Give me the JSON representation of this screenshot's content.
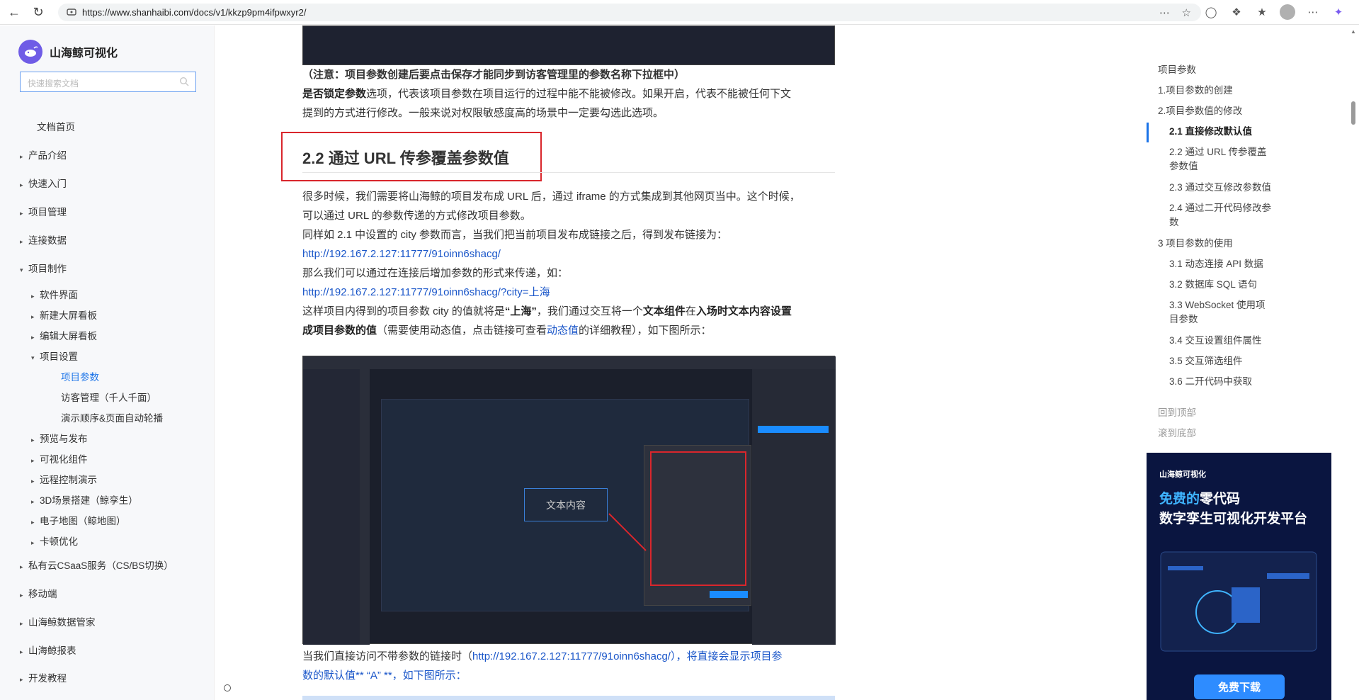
{
  "browser": {
    "url": "https://www.shanhaibi.com/docs/v1/kkzp9pm4ifpwxyr2/"
  },
  "sidebar": {
    "brand": "山海鲸可视化",
    "search_placeholder": "快速搜索文档",
    "items": [
      {
        "label": "文档首页",
        "caret": ""
      },
      {
        "label": "产品介绍",
        "caret": "▸"
      },
      {
        "label": "快速入门",
        "caret": "▸"
      },
      {
        "label": "项目管理",
        "caret": "▸"
      },
      {
        "label": "连接数据",
        "caret": "▸"
      },
      {
        "label": "项目制作",
        "caret": "▾"
      },
      {
        "label": "软件界面",
        "caret": "▸"
      },
      {
        "label": "新建大屏看板",
        "caret": "▸"
      },
      {
        "label": "编辑大屏看板",
        "caret": "▸"
      },
      {
        "label": "项目设置",
        "caret": "▾"
      },
      {
        "label": "项目参数",
        "caret": ""
      },
      {
        "label": "访客管理（千人千面）",
        "caret": ""
      },
      {
        "label": "演示顺序&页面自动轮播",
        "caret": ""
      },
      {
        "label": "预览与发布",
        "caret": "▸"
      },
      {
        "label": "可视化组件",
        "caret": "▸"
      },
      {
        "label": "远程控制演示",
        "caret": "▸"
      },
      {
        "label": "3D场景搭建（鲸孪生）",
        "caret": "▸"
      },
      {
        "label": "电子地图（鲸地图）",
        "caret": "▸"
      },
      {
        "label": "卡顿优化",
        "caret": "▸"
      },
      {
        "label": "私有云CSaaS服务（CS/BS切换）",
        "caret": "▸"
      },
      {
        "label": "移动端",
        "caret": "▸"
      },
      {
        "label": "山海鲸数据管家",
        "caret": "▸"
      },
      {
        "label": "山海鲸报表",
        "caret": "▸"
      },
      {
        "label": "开发教程",
        "caret": "▸"
      }
    ]
  },
  "article": {
    "note": "（注意：项目参数创建后要点击保存才能同步到访客管理里的参数名称下拉框中）",
    "lock_b": "是否锁定参数",
    "lock_t1": "选项，代表该项目参数在项目运行的过程中能不能被修改。如果开启，代表不能被任何下文",
    "lock_t2": "提到的方式进行修改。一般来说对权限敏感度高的场景中一定要勾选此选项。",
    "heading": "2.2 通过 URL 传参覆盖参数值",
    "p1a": "很多时候，我们需要将山海鲸的项目发布成 URL 后，通过 iframe 的方式集成到其他网页当中。这个时候，",
    "p1b": "可以通过 URL 的参数传递的方式修改项目参数。",
    "p2": "同样如 2.1 中设置的 city 参数而言，当我们把当前项目发布成链接之后，得到发布链接为：",
    "link1": "http://192.167.2.127:11777/91oinn6shacg/",
    "p3": "那么我们可以通过在连接后增加参数的形式来传递，如：",
    "link2": "http://192.167.2.127:11777/91oinn6shacg/?city=上海",
    "p4a": "这样项目内得到的项目参数 city 的值就将是",
    "p4b": "“上海”",
    "p4c": "，我们通过交互将一个",
    "p4d": "文本组件",
    "p4e": "在",
    "p4f": "入场时文本内容设置",
    "p5a": "成项目参数的值",
    "p5b": "（需要使用动态值，点击链接可查看",
    "p5c": "动态值",
    "p5d": "的详细教程），如下图所示：",
    "p6a": "当我们直接访问不带参数的链接时（",
    "p6b": "http://192.167.2.127:11777/91oinn6shacg/",
    "p6c": "），将直接会显示项目参",
    "p6d": "数的默认值** “A” **，如下图所示：",
    "screenshot_text": "文本内容"
  },
  "toc": {
    "items": [
      "项目参数",
      "1.项目参数的创建",
      "2.项目参数值的修改",
      "2.1 直接修改默认值",
      "2.2 通过 URL 传参覆盖",
      "参数值",
      "2.3 通过交互修改参数值",
      "2.4 通过二开代码修改参",
      "数",
      "3 项目参数的使用",
      "3.1 动态连接 API 数据",
      "3.2 数据库 SQL 语句",
      "3.3 WebSocket 使用项",
      "目参数",
      "3.4 交互设置组件属性",
      "3.5 交互筛选组件",
      "3.6 二开代码中获取"
    ],
    "back_top": "回到顶部",
    "to_bottom": "滚到底部"
  },
  "ad": {
    "logo": "山海鲸可视化",
    "line1_highlight": "免费的",
    "line1_rest": "零代码",
    "line2": "数字孪生可视化开发平台",
    "button": "免费下载"
  },
  "colors": {
    "accent": "#1a73e8",
    "link": "#1a56c9",
    "highlight_box": "#d9262c"
  }
}
